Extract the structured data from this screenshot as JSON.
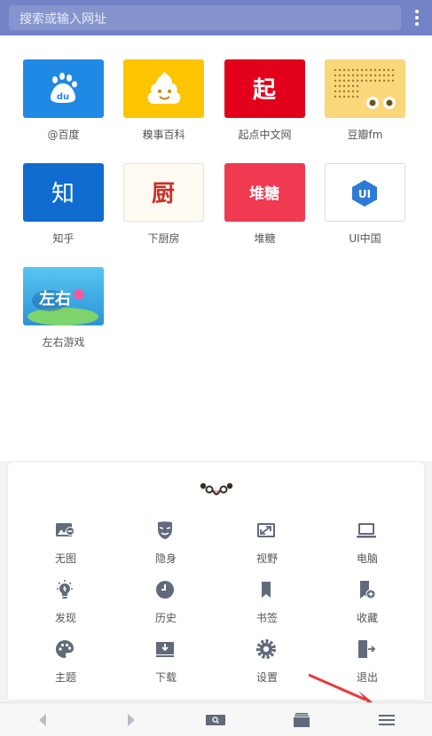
{
  "search": {
    "placeholder": "搜索或输入网址"
  },
  "shortcuts": [
    {
      "label": "@百度",
      "bg": "#1f89e5"
    },
    {
      "label": "糗事百科",
      "bg": "#fdc400"
    },
    {
      "label": "起点中文网",
      "bg": "#e2001b",
      "icon_text": "起"
    },
    {
      "label": "豆瓣fm",
      "bg": "#fad77b"
    },
    {
      "label": "知乎",
      "bg": "#0f6bce",
      "icon_text": "知"
    },
    {
      "label": "下厨房",
      "bg": "#fffaf2",
      "icon_text": "厨"
    },
    {
      "label": "堆糖",
      "bg": "#f03a52",
      "icon_text": "堆糖"
    },
    {
      "label": "UI中国",
      "bg": "#ffffff",
      "icon_text": "UI"
    },
    {
      "label": "左右游戏",
      "bg": "#3bb4e7",
      "icon_text": "左右"
    }
  ],
  "panel": {
    "items": [
      {
        "label": "无图",
        "icon": "no-image-icon"
      },
      {
        "label": "隐身",
        "icon": "incognito-mask-icon"
      },
      {
        "label": "视野",
        "icon": "fullscreen-icon"
      },
      {
        "label": "电脑",
        "icon": "desktop-laptop-icon"
      },
      {
        "label": "发现",
        "icon": "lightbulb-icon"
      },
      {
        "label": "历史",
        "icon": "history-clock-icon"
      },
      {
        "label": "书签",
        "icon": "bookmark-icon"
      },
      {
        "label": "收藏",
        "icon": "add-favorite-icon"
      },
      {
        "label": "主题",
        "icon": "palette-icon"
      },
      {
        "label": "下载",
        "icon": "download-icon"
      },
      {
        "label": "设置",
        "icon": "settings-gear-icon"
      },
      {
        "label": "退出",
        "icon": "exit-icon"
      }
    ]
  },
  "colors": {
    "topbar": "#7383c6",
    "icon": "#616a7a",
    "annotation_arrow": "#e8383d"
  }
}
